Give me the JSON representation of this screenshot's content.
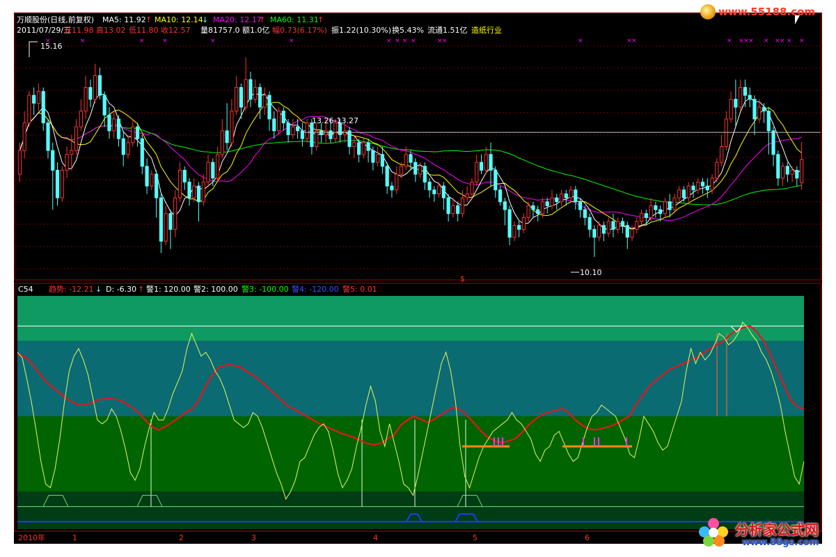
{
  "header": {
    "stock_name": "万顺股份(日线,前复权)",
    "ma5": "MA5: 11.92",
    "ma10": "MA10: 12.14",
    "ma20": "MA20: 12.17",
    "ma60": "MA60: 11.31",
    "arrow_up": "↑",
    "arrow_down": "↓"
  },
  "quote": {
    "date": "2011/07/29/五",
    "open": "开11.98",
    "high": "高13.02",
    "low": "低11.80",
    "close": "收12.57",
    "volume": "量81757.0",
    "amount": "额1.0亿",
    "change": "幅0.73(6.17%)",
    "amplitude": "振1.22(10.30%)",
    "turnover": "换5.43%",
    "float": "流通1.51亿",
    "industry": "造纸行业"
  },
  "price_labels": {
    "high_mark": "15.16",
    "range_mark": "13.26-13.27",
    "low_mark": "10.10",
    "signal_mark": "$"
  },
  "indicator_header": {
    "name": "C54",
    "trend": "趋势: -12.21",
    "d": "D: -6.30",
    "warn1": "警1: 120.00",
    "warn2": "警2: 100.00",
    "warn3": "警3: -100.00",
    "warn4": "警4: -120.00",
    "warn5": "警5: 0.01"
  },
  "xaxis": {
    "labels": [
      "2010年",
      "1",
      "2",
      "3",
      "4",
      "5",
      "6"
    ]
  },
  "watermarks": {
    "top": "www.55188.com",
    "bottom_cn": "分析家公式网",
    "bottom_url": "www.88gs.com"
  },
  "colors": {
    "up": "#ff3232",
    "down": "#54ffff",
    "ma5": "#ffffff",
    "ma10": "#ffff00",
    "ma20": "#ff00ff",
    "ma60": "#00ff00",
    "trend": "#e8141c",
    "d": "#e8f560",
    "grid": "#7a0000"
  },
  "chart_data": {
    "type": "candlestick",
    "ylim": [
      9.5,
      15.7
    ],
    "candles": [
      [
        12.2,
        12.8,
        12.0,
        13.0
      ],
      [
        12.8,
        13.5,
        12.6,
        13.8
      ],
      [
        13.5,
        14.2,
        13.4,
        14.3
      ],
      [
        14.2,
        14.0,
        13.7,
        14.4
      ],
      [
        14.0,
        14.3,
        13.8,
        14.5
      ],
      [
        14.3,
        13.5,
        13.3,
        14.4
      ],
      [
        13.5,
        12.8,
        12.6,
        13.6
      ],
      [
        12.8,
        12.3,
        11.3,
        13.0
      ],
      [
        12.3,
        11.6,
        11.4,
        12.5
      ],
      [
        11.6,
        12.3,
        11.5,
        12.4
      ],
      [
        12.3,
        12.7,
        12.1,
        12.9
      ],
      [
        12.7,
        12.8,
        12.3,
        13.2
      ],
      [
        12.8,
        13.4,
        12.7,
        13.6
      ],
      [
        13.4,
        13.8,
        13.3,
        14.1
      ],
      [
        13.8,
        14.4,
        13.6,
        14.7
      ],
      [
        14.4,
        14.1,
        13.9,
        14.6
      ],
      [
        14.1,
        14.7,
        14.0,
        15.0
      ],
      [
        14.7,
        14.2,
        14.1,
        14.9
      ],
      [
        14.2,
        13.7,
        13.4,
        14.3
      ],
      [
        13.7,
        13.3,
        13.1,
        13.9
      ],
      [
        13.3,
        13.6,
        13.1,
        13.8
      ],
      [
        13.6,
        13.1,
        12.9,
        13.7
      ],
      [
        13.1,
        12.7,
        12.4,
        13.3
      ],
      [
        12.7,
        13.0,
        12.6,
        13.2
      ],
      [
        13.0,
        13.4,
        12.9,
        13.6
      ],
      [
        13.4,
        13.1,
        12.9,
        13.5
      ],
      [
        13.1,
        12.4,
        12.2,
        13.2
      ],
      [
        12.4,
        11.9,
        11.7,
        12.6
      ],
      [
        11.9,
        12.2,
        11.8,
        12.3
      ],
      [
        12.2,
        11.6,
        11.1,
        12.3
      ],
      [
        11.6,
        10.5,
        10.2,
        11.7
      ],
      [
        10.5,
        11.2,
        10.4,
        11.4
      ],
      [
        11.2,
        10.8,
        10.3,
        11.3
      ],
      [
        10.8,
        11.6,
        10.6,
        11.8
      ],
      [
        11.6,
        12.3,
        11.5,
        12.5
      ],
      [
        12.3,
        12.0,
        11.8,
        12.4
      ],
      [
        12.0,
        11.6,
        11.4,
        12.1
      ],
      [
        11.6,
        11.9,
        11.5,
        12.1
      ],
      [
        11.9,
        11.5,
        11.0,
        12.0
      ],
      [
        11.5,
        12.0,
        11.4,
        12.2
      ],
      [
        12.0,
        12.5,
        11.9,
        12.7
      ],
      [
        12.5,
        12.1,
        11.9,
        12.6
      ],
      [
        12.1,
        12.7,
        12.0,
        12.9
      ],
      [
        12.7,
        13.3,
        12.6,
        13.6
      ],
      [
        13.3,
        13.0,
        12.8,
        14.0
      ],
      [
        13.0,
        13.8,
        12.9,
        14.1
      ],
      [
        13.8,
        14.4,
        13.7,
        14.7
      ],
      [
        14.4,
        13.9,
        13.6,
        14.5
      ],
      [
        13.9,
        14.6,
        13.8,
        15.16
      ],
      [
        14.6,
        14.1,
        13.9,
        14.8
      ],
      [
        14.1,
        14.4,
        14.0,
        14.6
      ],
      [
        14.4,
        13.9,
        13.6,
        14.5
      ],
      [
        13.9,
        14.2,
        13.7,
        14.4
      ],
      [
        14.2,
        13.6,
        13.3,
        14.3
      ],
      [
        13.6,
        13.3,
        13.1,
        13.8
      ],
      [
        13.3,
        13.8,
        13.2,
        13.9
      ],
      [
        13.8,
        13.5,
        13.3,
        13.9
      ],
      [
        13.5,
        13.2,
        13.0,
        13.6
      ],
      [
        13.2,
        13.4,
        13.1,
        13.6
      ],
      [
        13.4,
        13.3,
        13.1,
        13.6
      ],
      [
        13.3,
        13.1,
        12.9,
        13.5
      ],
      [
        13.1,
        13.5,
        13.0,
        13.6
      ],
      [
        13.5,
        12.9,
        12.7,
        13.6
      ],
      [
        12.9,
        13.3,
        12.8,
        13.5
      ],
      [
        13.3,
        13.2,
        13.0,
        13.5
      ],
      [
        13.2,
        13.3,
        13.0,
        13.6
      ],
      [
        13.3,
        13.1,
        13.0,
        13.6
      ],
      [
        13.1,
        13.5,
        13.0,
        13.6
      ],
      [
        13.5,
        13.2,
        13.0,
        13.6
      ],
      [
        13.2,
        13.3,
        13.0,
        13.5
      ],
      [
        13.3,
        12.9,
        12.7,
        13.4
      ],
      [
        12.9,
        13.0,
        12.6,
        13.2
      ],
      [
        13.0,
        12.7,
        12.5,
        13.1
      ],
      [
        12.7,
        13.0,
        12.6,
        13.1
      ],
      [
        13.0,
        12.8,
        12.5,
        13.1
      ],
      [
        12.8,
        12.5,
        12.3,
        12.9
      ],
      [
        12.5,
        12.7,
        12.4,
        12.9
      ],
      [
        12.7,
        12.4,
        12.2,
        12.9
      ],
      [
        12.4,
        11.9,
        11.7,
        12.5
      ],
      [
        11.9,
        11.8,
        11.6,
        12.0
      ],
      [
        11.8,
        12.2,
        11.7,
        12.4
      ],
      [
        12.2,
        12.4,
        12.1,
        12.5
      ],
      [
        12.4,
        12.7,
        12.3,
        12.9
      ],
      [
        12.7,
        12.5,
        12.3,
        12.8
      ],
      [
        12.5,
        12.2,
        12.0,
        12.6
      ],
      [
        12.2,
        12.4,
        12.1,
        12.5
      ],
      [
        12.4,
        12.0,
        11.8,
        12.5
      ],
      [
        12.0,
        11.8,
        11.6,
        12.1
      ],
      [
        11.8,
        11.7,
        11.5,
        11.9
      ],
      [
        11.7,
        11.9,
        11.6,
        12.0
      ],
      [
        11.9,
        11.6,
        11.3,
        12.0
      ],
      [
        11.6,
        11.2,
        11.0,
        11.7
      ],
      [
        11.2,
        11.4,
        11.1,
        11.6
      ],
      [
        11.4,
        11.2,
        11.0,
        11.5
      ],
      [
        11.2,
        11.6,
        11.1,
        11.8
      ],
      [
        11.6,
        11.7,
        11.5,
        11.9
      ],
      [
        11.7,
        12.0,
        11.6,
        12.1
      ],
      [
        12.0,
        12.5,
        11.9,
        12.7
      ],
      [
        12.5,
        12.3,
        12.2,
        12.7
      ],
      [
        12.3,
        12.7,
        12.2,
        12.9
      ],
      [
        12.7,
        12.3,
        11.9,
        13.0
      ],
      [
        12.3,
        11.8,
        11.6,
        12.4
      ],
      [
        11.8,
        11.5,
        11.4,
        11.9
      ],
      [
        11.5,
        11.3,
        10.9,
        11.6
      ],
      [
        11.3,
        10.6,
        10.4,
        11.4
      ],
      [
        10.6,
        10.9,
        10.5,
        11.0
      ],
      [
        10.9,
        10.8,
        10.6,
        11.0
      ],
      [
        10.8,
        11.1,
        10.7,
        11.2
      ],
      [
        11.1,
        11.4,
        11.0,
        11.5
      ],
      [
        11.4,
        11.3,
        11.1,
        11.5
      ],
      [
        11.3,
        11.2,
        11.0,
        11.4
      ],
      [
        11.2,
        11.5,
        11.1,
        11.6
      ],
      [
        11.5,
        11.4,
        11.2,
        11.6
      ],
      [
        11.4,
        11.6,
        11.3,
        11.8
      ],
      [
        11.6,
        11.5,
        11.3,
        11.7
      ],
      [
        11.5,
        11.7,
        11.4,
        11.8
      ],
      [
        11.7,
        11.6,
        11.4,
        11.8
      ],
      [
        11.6,
        11.8,
        11.5,
        11.9
      ],
      [
        11.8,
        11.5,
        11.3,
        11.9
      ],
      [
        11.5,
        11.3,
        11.1,
        11.6
      ],
      [
        11.3,
        11.1,
        10.9,
        11.4
      ],
      [
        11.1,
        10.8,
        10.6,
        11.2
      ],
      [
        10.8,
        10.6,
        10.1,
        10.9
      ],
      [
        10.6,
        10.9,
        10.5,
        11.0
      ],
      [
        10.9,
        10.7,
        10.5,
        11.0
      ],
      [
        10.7,
        11.0,
        10.6,
        11.1
      ],
      [
        11.0,
        10.8,
        10.6,
        11.2
      ],
      [
        10.8,
        11.0,
        10.7,
        11.1
      ],
      [
        11.0,
        10.9,
        10.7,
        11.1
      ],
      [
        10.9,
        10.6,
        10.3,
        11.0
      ],
      [
        10.6,
        10.8,
        10.5,
        10.9
      ],
      [
        10.8,
        11.0,
        10.7,
        11.1
      ],
      [
        11.0,
        11.2,
        10.9,
        11.3
      ],
      [
        11.2,
        11.1,
        10.9,
        11.3
      ],
      [
        11.1,
        11.4,
        11.0,
        11.6
      ],
      [
        11.4,
        11.3,
        11.1,
        11.5
      ],
      [
        11.3,
        11.2,
        11.0,
        11.4
      ],
      [
        11.2,
        11.5,
        11.1,
        11.6
      ],
      [
        11.5,
        11.3,
        11.1,
        11.7
      ],
      [
        11.3,
        11.6,
        11.2,
        11.7
      ],
      [
        11.6,
        11.8,
        11.5,
        11.9
      ],
      [
        11.8,
        11.6,
        11.5,
        11.9
      ],
      [
        11.6,
        11.9,
        11.5,
        12.0
      ],
      [
        11.9,
        11.8,
        11.6,
        12.0
      ],
      [
        11.8,
        12.0,
        11.7,
        12.1
      ],
      [
        12.0,
        11.9,
        11.7,
        12.1
      ],
      [
        11.9,
        11.8,
        11.6,
        12.1
      ],
      [
        11.8,
        12.1,
        11.7,
        12.2
      ],
      [
        12.1,
        12.5,
        12.0,
        12.6
      ],
      [
        12.5,
        12.9,
        12.4,
        13.2
      ],
      [
        12.9,
        13.6,
        12.8,
        13.8
      ],
      [
        13.6,
        14.1,
        13.5,
        14.3
      ],
      [
        14.1,
        13.9,
        13.4,
        14.6
      ],
      [
        13.9,
        14.4,
        13.8,
        14.6
      ],
      [
        14.4,
        14.2,
        13.9,
        14.6
      ],
      [
        14.2,
        14.1,
        13.9,
        14.4
      ],
      [
        14.1,
        13.6,
        13.2,
        14.2
      ],
      [
        13.6,
        13.9,
        13.5,
        14.1
      ],
      [
        13.9,
        13.8,
        13.5,
        14.0
      ],
      [
        13.8,
        13.3,
        12.7,
        13.9
      ],
      [
        13.3,
        12.7,
        12.4,
        13.4
      ],
      [
        12.7,
        12.1,
        11.9,
        12.8
      ],
      [
        12.1,
        12.4,
        11.9,
        12.5
      ],
      [
        12.4,
        12.2,
        12.0,
        12.5
      ],
      [
        12.2,
        12.3,
        12.0,
        12.4
      ],
      [
        12.3,
        12.1,
        11.9,
        12.4
      ],
      [
        11.98,
        12.57,
        11.8,
        13.02
      ]
    ]
  },
  "indicator_data": {
    "ylim": [
      -150,
      160
    ],
    "levels": [
      120,
      100,
      0,
      -100,
      -120
    ],
    "trend": [
      82,
      80,
      72,
      60,
      48,
      40,
      33,
      25,
      20,
      15,
      15,
      18,
      22,
      23,
      23,
      22,
      18,
      12,
      5,
      -5,
      -14,
      -18,
      -14,
      -8,
      -2,
      5,
      10,
      22,
      40,
      55,
      65,
      68,
      68,
      66,
      60,
      55,
      48,
      40,
      32,
      24,
      15,
      10,
      5,
      0,
      -5,
      -10,
      -14,
      -18,
      -22,
      -25,
      -28,
      -32,
      -36,
      -38,
      -36,
      -30,
      -25,
      -12,
      -5,
      0,
      -4,
      -8,
      -4,
      2,
      8,
      12,
      8,
      0,
      -10,
      -20,
      -28,
      -33,
      -35,
      -33,
      -30,
      -22,
      -12,
      -4,
      2,
      5,
      8,
      10,
      5,
      -5,
      -12,
      -17,
      -18,
      -16,
      -14,
      -10,
      -5,
      0,
      15,
      28,
      40,
      48,
      55,
      62,
      66,
      70,
      74,
      78,
      84,
      90,
      95,
      100,
      108,
      115,
      118,
      120,
      112,
      100,
      82,
      62,
      42,
      22,
      12,
      10
    ],
    "d": [
      85,
      78,
      50,
      18,
      -20,
      -60,
      -90,
      -95,
      -70,
      -30,
      20,
      60,
      80,
      90,
      75,
      55,
      25,
      -5,
      -10,
      -5,
      10,
      0,
      -20,
      -45,
      -75,
      -85,
      -70,
      -40,
      -15,
      5,
      -5,
      -5,
      10,
      30,
      45,
      60,
      90,
      110,
      95,
      80,
      85,
      75,
      60,
      50,
      35,
      15,
      -5,
      -10,
      -15,
      -10,
      5,
      0,
      -15,
      -35,
      -55,
      -75,
      -90,
      -110,
      -100,
      -85,
      -60,
      -55,
      -40,
      -25,
      -15,
      -10,
      -20,
      -45,
      -75,
      -95,
      -85,
      -70,
      -40,
      -15,
      15,
      40,
      20,
      -20,
      -40,
      -10,
      -35,
      -60,
      -90,
      -95,
      -105,
      -80,
      -50,
      -20,
      10,
      40,
      70,
      85,
      60,
      20,
      -40,
      -80,
      -95,
      -75,
      -55,
      -40,
      -30,
      -20,
      -15,
      -10,
      -5,
      5,
      -5,
      -10,
      -20,
      -30,
      -50,
      -60,
      -45,
      -40,
      -25,
      -20,
      -35,
      -50,
      -60,
      -55,
      -35,
      -15,
      0,
      5,
      15,
      10,
      5,
      0,
      -15,
      -30,
      -50,
      -55,
      -30,
      0,
      -10,
      -20,
      -35,
      -45,
      -40,
      -20,
      0,
      20,
      60,
      90,
      70,
      85,
      75,
      82,
      95,
      110,
      105,
      95,
      100,
      110,
      125,
      118,
      108,
      100,
      85,
      75,
      60,
      40,
      15,
      -20,
      -50,
      -80,
      -90,
      -60
    ]
  }
}
